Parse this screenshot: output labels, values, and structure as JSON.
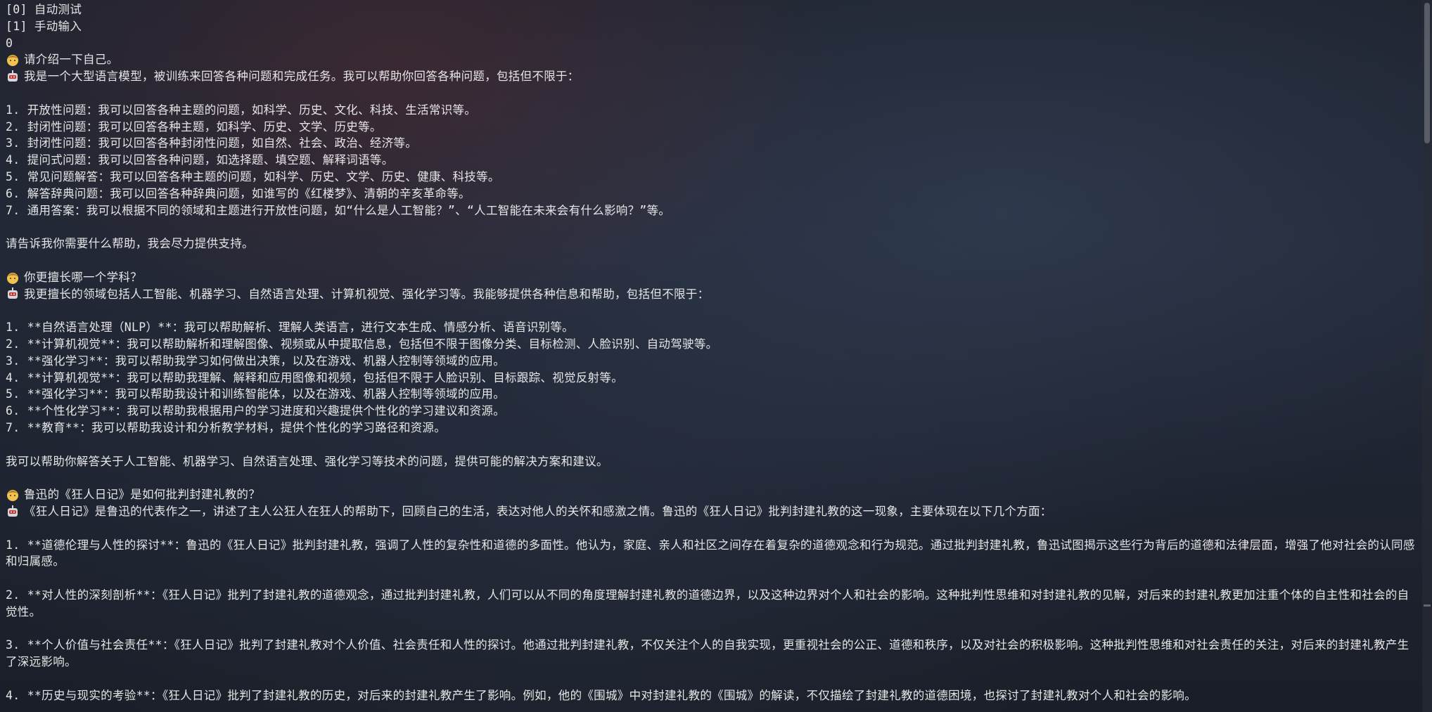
{
  "terminal": {
    "menu": [
      "[0] 自动测试",
      "[1] 手动输入"
    ],
    "choice": "0",
    "conversation": [
      {
        "question": "请介绍一下自己。",
        "answer_intro": "我是一个大型语言模型，被训练来回答各种问题和完成任务。我可以帮助你回答各种问题，包括但不限于：",
        "items": [
          "1. 开放性问题：我可以回答各种主题的问题，如科学、历史、文化、科技、生活常识等。",
          "2. 封闭性问题：我可以回答各种主题，如科学、历史、文学、历史等。",
          "3. 封闭性问题：我可以回答各种封闭性问题，如自然、社会、政治、经济等。",
          "4. 提问式问题：我可以回答各种问题，如选择题、填空题、解释词语等。",
          "5. 常见问题解答：我可以回答各种主题的问题，如科学、历史、文学、历史、健康、科技等。",
          "6. 解答辞典问题：我可以回答各种辞典问题，如谁写的《红楼梦》、清朝的辛亥革命等。",
          "7. 通用答案：我可以根据不同的领域和主题进行开放性问题，如“什么是人工智能？”、“人工智能在未来会有什么影响？”等。"
        ],
        "closing": "请告诉我你需要什么帮助，我会尽力提供支持。"
      },
      {
        "question": "你更擅长哪一个学科？",
        "answer_intro": "我更擅长的领域包括人工智能、机器学习、自然语言处理、计算机视觉、强化学习等。我能够提供各种信息和帮助，包括但不限于：",
        "items": [
          "1. **自然语言处理（NLP）**：我可以帮助解析、理解人类语言，进行文本生成、情感分析、语音识别等。",
          "2. **计算机视觉**：我可以帮助解析和理解图像、视频或从中提取信息，包括但不限于图像分类、目标检测、人脸识别、自动驾驶等。",
          "3. **强化学习**：我可以帮助我学习如何做出决策，以及在游戏、机器人控制等领域的应用。",
          "4. **计算机视觉**：我可以帮助我理解、解释和应用图像和视频，包括但不限于人脸识别、目标跟踪、视觉反射等。",
          "5. **强化学习**：我可以帮助我设计和训练智能体，以及在游戏、机器人控制等领域的应用。",
          "6. **个性化学习**：我可以帮助我根据用户的学习进度和兴趣提供个性化的学习建议和资源。",
          "7. **教育**：我可以帮助我设计和分析教学材料，提供个性化的学习路径和资源。"
        ],
        "closing": "我可以帮助你解答关于人工智能、机器学习、自然语言处理、强化学习等技术的问题，提供可能的解决方案和建议。"
      },
      {
        "question": "鲁迅的《狂人日记》是如何批判封建礼教的？",
        "answer_intro": "《狂人日记》是鲁迅的代表作之一，讲述了主人公狂人在狂人的帮助下，回顾自己的生活，表达对他人的关怀和感激之情。鲁迅的《狂人日记》批判封建礼教的这一现象，主要体现在以下几个方面：",
        "paragraphs": [
          "1. **道德伦理与人性的探讨**：鲁迅的《狂人日记》批判封建礼教，强调了人性的复杂性和道德的多面性。他认为，家庭、亲人和社区之间存在着复杂的道德观念和行为规范。通过批判封建礼教，鲁迅试图揭示这些行为背后的道德和法律层面，增强了他对社会的认同感和归属感。",
          "2. **对人性的深刻剖析**：《狂人日记》批判了封建礼教的道德观念，通过批判封建礼教，人们可以从不同的角度理解封建礼教的道德边界，以及这种边界对个人和社会的影响。这种批判性思维和对封建礼教的见解，对后来的封建礼教更加注重个体的自主性和社会的自觉性。",
          "3. **个人价值与社会责任**：《狂人日记》批判了封建礼教对个人价值、社会责任和人性的探讨。他通过批判封建礼教，不仅关注个人的自我实现，更重视社会的公正、道德和秩序，以及对社会的积极影响。这种批判性思维和对社会责任的关注，对后来的封建礼教产生了深远影响。",
          "4. **历史与现实的考验**：《狂人日记》批判了封建礼教的历史，对后来的封建礼教产生了影响。例如，他的《围城》中对封建礼教的《围城》的解读，不仅描绘了封建礼教的道德困境，也探讨了封建礼教对个人和社会的影响。"
        ]
      }
    ],
    "user_icon": "user-face-icon",
    "bot_icon": "robot-icon"
  }
}
